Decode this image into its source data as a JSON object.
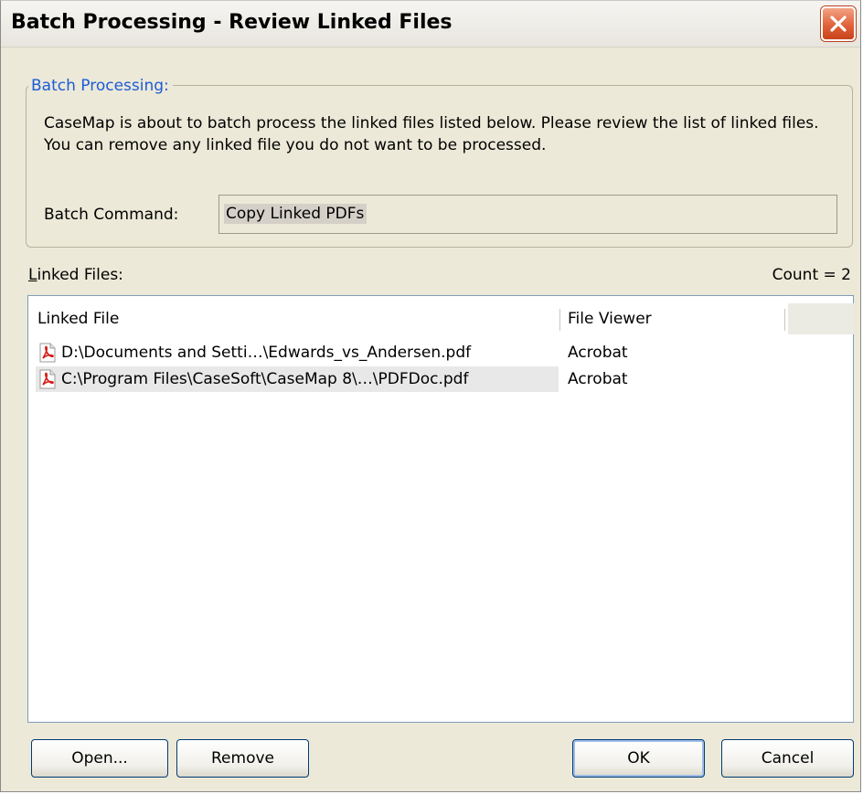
{
  "window": {
    "title": "Batch Processing - Review Linked Files"
  },
  "group": {
    "legend": "Batch Processing:",
    "description": "CaseMap is about to batch process the linked files listed below.  Please review the list of linked files.  You can remove any linked file you do not want to be processed.",
    "command_label": "Batch Command:",
    "command_value": "Copy Linked PDFs"
  },
  "linked_files": {
    "label_mnemonic": "L",
    "label_rest": "inked Files:",
    "count": "Count = 2",
    "columns": [
      "Linked File",
      "File Viewer"
    ],
    "rows": [
      {
        "file": "D:\\Documents and Setti…\\Edwards_vs_Andersen.pdf",
        "viewer": "Acrobat",
        "icon": "pdf-icon"
      },
      {
        "file": "C:\\Program Files\\CaseSoft\\CaseMap 8\\…\\PDFDoc.pdf",
        "viewer": "Acrobat",
        "icon": "pdf-icon",
        "selected": true
      }
    ]
  },
  "buttons": {
    "open": "Open...",
    "remove": "Remove",
    "ok": "OK",
    "cancel": "Cancel"
  },
  "colors": {
    "dialog_bg": "#ece9d8",
    "legend_blue": "#1c5bd8",
    "close_red": "#e0623a",
    "pdf_red": "#d6201c"
  }
}
